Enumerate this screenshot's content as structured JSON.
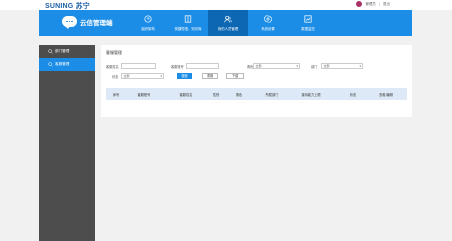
{
  "brand": {
    "logo": "SUNING 苏宁",
    "title": "云信管理端"
  },
  "user": {
    "name": "管理员",
    "logout": "退出"
  },
  "nav": [
    {
      "label": "组织架构",
      "icon": "clock-icon"
    },
    {
      "label": "快捷短语、知识库",
      "icon": "book-icon"
    },
    {
      "label": "我的人员管理",
      "icon": "user-icon"
    },
    {
      "label": "系统设置",
      "icon": "gear-icon"
    },
    {
      "label": "数据监控",
      "icon": "chart-icon"
    }
  ],
  "sidebar": [
    {
      "label": "部门管理"
    },
    {
      "label": "客服管理"
    }
  ],
  "panel": {
    "title": "客服管理",
    "filters": {
      "name_label": "客服姓名",
      "account_label": "客服账号",
      "role_label": "角色",
      "role_value": "全部",
      "dept_label": "部门",
      "dept_value": "全部",
      "status_label": "状态",
      "status_value": "全部"
    },
    "buttons": {
      "search": "搜索",
      "reset": "重置",
      "download": "下载"
    },
    "columns": [
      "序号",
      "客服账号",
      "客服姓名",
      "性别",
      "角色",
      "所属部门",
      "接待能力上限",
      "状态",
      "查看/编辑"
    ]
  }
}
